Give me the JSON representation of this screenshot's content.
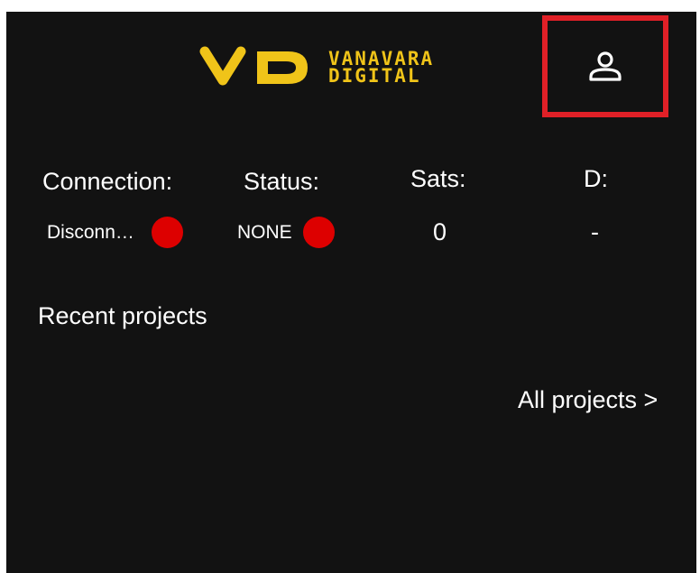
{
  "brand": {
    "name_line1": "VANAVARA",
    "name_line2": "DIGITAL",
    "accent_color": "#f0c419"
  },
  "header": {
    "profile_icon": "user-icon",
    "highlight_color": "#e02027"
  },
  "stats": {
    "connection": {
      "label": "Connection:",
      "value": "Disconn…",
      "indicator_color": "#dd0000"
    },
    "status": {
      "label": "Status:",
      "value": "NONE",
      "indicator_color": "#dd0000"
    },
    "sats": {
      "label": "Sats:",
      "value": "0"
    },
    "d": {
      "label": "D:",
      "value": "-"
    }
  },
  "projects": {
    "title": "Recent projects",
    "all_link": "All projects >"
  }
}
